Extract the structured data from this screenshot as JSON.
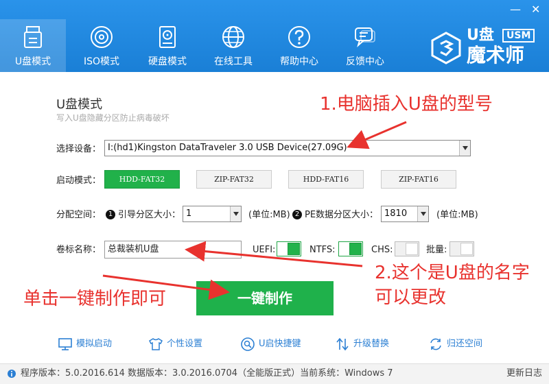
{
  "window": {
    "minimize": "—",
    "close": "✕"
  },
  "nav": [
    {
      "label": "U盘模式",
      "icon": "usb-drive-icon"
    },
    {
      "label": "ISO模式",
      "icon": "disc-icon"
    },
    {
      "label": "硬盘模式",
      "icon": "hard-disk-icon"
    },
    {
      "label": "在线工具",
      "icon": "globe-icon"
    },
    {
      "label": "帮助中心",
      "icon": "question-icon"
    },
    {
      "label": "反馈中心",
      "icon": "chat-icon"
    }
  ],
  "logo": {
    "main": "U盘",
    "usm": "USM",
    "brand": "魔术师"
  },
  "section": {
    "title": "U盘模式",
    "subtitle": "写入U盘隐藏分区防止病毒破坏"
  },
  "device": {
    "label": "选择设备：",
    "value": "I:(hd1)Kingston DataTraveler 3.0 USB Device(27.09G)"
  },
  "boot": {
    "label": "启动模式：",
    "modes": [
      "HDD-FAT32",
      "ZIP-FAT32",
      "HDD-FAT16",
      "ZIP-FAT16"
    ],
    "selected": "HDD-FAT32"
  },
  "partition": {
    "label": "分配空间：",
    "num1": "1",
    "boot_label": "引导分区大小：",
    "boot_value": "1",
    "unit1": "(单位:MB)",
    "num2": "2",
    "pe_label": "PE数据分区大小：",
    "pe_value": "1810",
    "unit2": "(单位:MB)"
  },
  "volume": {
    "label": "卷标名称：",
    "value": "总裁装机U盘"
  },
  "toggles": [
    {
      "label": "UEFI:",
      "on": true
    },
    {
      "label": "NTFS:",
      "on": true
    },
    {
      "label": "CHS:",
      "on": false
    },
    {
      "label": "批量:",
      "on": false
    }
  ],
  "action": {
    "label": "一键制作"
  },
  "annotations": {
    "a1": "1.电脑插入U盘的型号",
    "a2_line1": "2.这个是U盘的名字",
    "a2_line2": "可以更改",
    "a3": "单击一键制作即可"
  },
  "tools": [
    {
      "label": "模拟启动",
      "icon": "monitor-icon"
    },
    {
      "label": "个性设置",
      "icon": "shirt-icon"
    },
    {
      "label": "U启快捷键",
      "icon": "key-search-icon"
    },
    {
      "label": "升级替换",
      "icon": "upgrade-icon"
    },
    {
      "label": "归还空间",
      "icon": "restore-icon"
    }
  ],
  "status": {
    "text": "程序版本：5.0.2016.614  数据版本：3.0.2016.0704（全能版正式）当前系统：Windows 7",
    "changelog": "更新日志"
  },
  "colors": {
    "header": "#1e88e5",
    "accent_green": "#21b14a",
    "annotation_red": "#e8322e",
    "link_blue": "#2b7fd3"
  }
}
